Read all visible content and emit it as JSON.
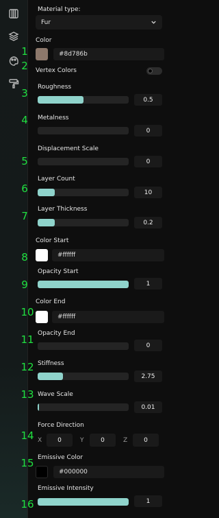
{
  "sidebar": {
    "icons": [
      "film-icon",
      "layers-icon",
      "palette-icon",
      "paint-roller-icon"
    ]
  },
  "annotations": [
    "1",
    "2",
    "3",
    "4",
    "5",
    "6",
    "7",
    "8",
    "9",
    "10",
    "11",
    "12",
    "13",
    "14",
    "15",
    "16"
  ],
  "material_type": {
    "label": "Material type:",
    "value": "Fur"
  },
  "color": {
    "label": "Color",
    "value": "#8d786b",
    "swatch": "#8d786b"
  },
  "vertex_colors": {
    "label": "Vertex Colors",
    "enabled": false
  },
  "roughness": {
    "label": "Roughness",
    "value": "0.5",
    "fraction": 0.5
  },
  "metalness": {
    "label": "Metalness",
    "value": "0",
    "fraction": 0
  },
  "displacement_scale": {
    "label": "Displacement Scale",
    "value": "0",
    "fraction": 0
  },
  "layer_count": {
    "label": "Layer Count",
    "value": "10",
    "fraction": 0.19
  },
  "layer_thickness": {
    "label": "Layer Thickness",
    "value": "0.2",
    "fraction": 0.19
  },
  "color_start": {
    "label": "Color Start",
    "value": "#ffffff",
    "swatch": "#ffffff"
  },
  "opacity_start": {
    "label": "Opacity Start",
    "value": "1",
    "fraction": 1
  },
  "color_end": {
    "label": "Color End",
    "value": "#ffffff",
    "swatch": "#ffffff"
  },
  "opacity_end": {
    "label": "Opacity End",
    "value": "0",
    "fraction": 0
  },
  "stiffness": {
    "label": "Stiffness",
    "value": "2.75",
    "fraction": 0.28
  },
  "wave_scale": {
    "label": "Wave Scale",
    "value": "0.01",
    "fraction": 0.01
  },
  "force_direction": {
    "label": "Force Direction",
    "x_label": "X",
    "x": "0",
    "y_label": "Y",
    "y": "0",
    "z_label": "Z",
    "z": "0"
  },
  "emissive_color": {
    "label": "Emissive Color",
    "value": "#000000",
    "swatch": "#000000"
  },
  "emissive_intensity": {
    "label": "Emissive Intensity",
    "value": "1",
    "fraction": 1
  },
  "accent_color": "#8fd3cb",
  "annotation_color": "#20e040"
}
